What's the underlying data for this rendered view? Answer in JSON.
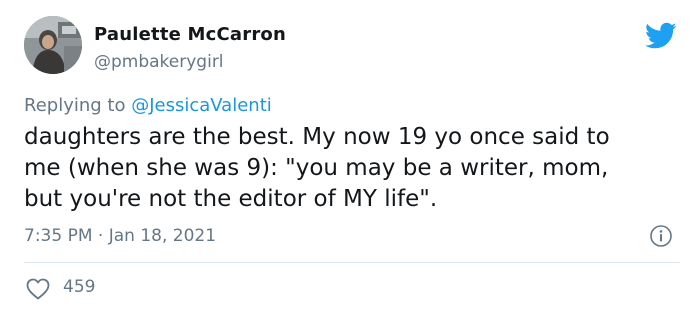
{
  "author": {
    "display_name": "Paulette McCarron",
    "handle": "@pmbakerygirl"
  },
  "reply": {
    "prefix": "Replying to ",
    "mention": "@JessicaValenti"
  },
  "tweet": {
    "text_lines": [
      "daughters are the best. My now 19 yo once said to",
      "me (when she was 9): \"you may be a writer, mom,",
      "but you're not the editor of MY life\"."
    ],
    "timestamp": "7:35 PM · Jan 18, 2021"
  },
  "engagement": {
    "likes": "459"
  },
  "icons": {
    "brand": "twitter-bird-icon",
    "info": "info-icon",
    "like": "heart-icon"
  },
  "colors": {
    "brand_blue": "#1da1f2",
    "mention_blue": "#1b95e0",
    "muted_text": "#657786",
    "primary_text": "#14171a",
    "divider": "#e1e8ed"
  }
}
